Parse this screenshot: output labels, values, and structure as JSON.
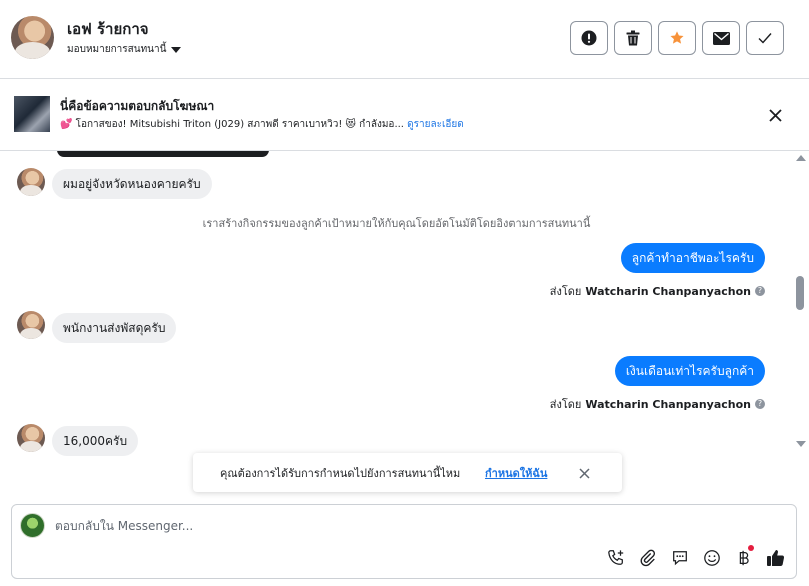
{
  "header": {
    "contact_name": "เอฟ ร้ายกาจ",
    "assign_label": "มอบหมายการสนทนานี้",
    "actions": [
      {
        "icon": "exclamation-icon",
        "label": "Mark as spam"
      },
      {
        "icon": "trash-icon",
        "label": "Delete"
      },
      {
        "icon": "star-icon",
        "label": "Star"
      },
      {
        "icon": "envelope-icon",
        "label": "Mark as unread"
      },
      {
        "icon": "check-icon",
        "label": "Mark as done"
      }
    ],
    "star_color": "#f7923a"
  },
  "ad_banner": {
    "title": "นี่คือข้อความตอบกลับโฆษณา",
    "description": "💕 โอกาสของ! Mitsubishi Triton (J029) สภาพดี ราคาเบาหวิว! 😻 กำลังมอ...",
    "details_link": "ดูรายละเอียด"
  },
  "thread": {
    "messages": [
      {
        "side": "in",
        "text": "ผมอยู่จังหวัดหนองคายครับ"
      },
      {
        "side": "system",
        "text": "เราสร้างกิจกรรมของลูกค้าเป้าหมายให้กับคุณโดยอัตโนมัติโดยอิงตามการสนทนานี้"
      },
      {
        "side": "out",
        "text": "ลูกค้าทำอาชีพอะไรครับ",
        "sent_by_prefix": "ส่งโดย",
        "sender": "Watcharin Chanpanyachon"
      },
      {
        "side": "in",
        "text": "พนักงานส่งพัสดุครับ"
      },
      {
        "side": "out",
        "text": "เงินเดือนเท่าไรครับลูกค้า",
        "sent_by_prefix": "ส่งโดย",
        "sender": "Watcharin Chanpanyachon"
      },
      {
        "side": "in",
        "text": "16,000ครับ"
      }
    ],
    "outgoing_bubble_color": "#0a7cff",
    "incoming_bubble_color": "#eeeff1"
  },
  "toast": {
    "text": "คุณต้องการได้รับการกำหนดไปยังการสนทนานี้ไหม",
    "action": "กำหนดให้ฉัน"
  },
  "composer": {
    "placeholder": "ตอบกลับใน Messenger...",
    "tools": [
      "call-add-icon",
      "paperclip-icon",
      "chat-bubble-icon",
      "emoji-icon",
      "baht-icon",
      "like-icon"
    ],
    "accent_color": "#1b74e4"
  }
}
